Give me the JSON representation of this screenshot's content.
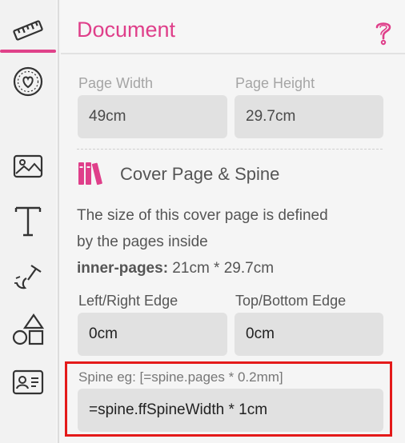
{
  "toolbar": {
    "tools": [
      {
        "icon": "ruler-icon",
        "active": true
      },
      {
        "icon": "heart-circle-icon",
        "active": false
      },
      {
        "icon": "image-icon",
        "active": false
      },
      {
        "icon": "text-icon",
        "active": false
      },
      {
        "icon": "brush-icon",
        "active": false
      },
      {
        "icon": "shapes-icon",
        "active": false
      },
      {
        "icon": "id-card-icon",
        "active": false
      }
    ]
  },
  "panel": {
    "title": "Document",
    "help_icon": "question-icon",
    "page_width_label": "Page Width",
    "page_width_value": "49cm",
    "page_height_label": "Page Height",
    "page_height_value": "29.7cm",
    "section_icon": "books-icon",
    "section_title": "Cover Page & Spine",
    "desc_line1": "The size of this cover page is defined",
    "desc_line2": "by the pages inside",
    "desc_bold": "inner-pages:",
    "desc_size": " 21cm * 29.7cm",
    "lr_edge_label": "Left/Right Edge",
    "lr_edge_value": "0cm",
    "tb_edge_label": "Top/Bottom Edge",
    "tb_edge_value": "0cm",
    "spine_label": "Spine eg: [=spine.pages * 0.2mm]",
    "spine_value": "=spine.ffSpineWidth * 1cm"
  },
  "colors": {
    "accent": "#df3f8a",
    "highlight": "#e41a1a"
  }
}
